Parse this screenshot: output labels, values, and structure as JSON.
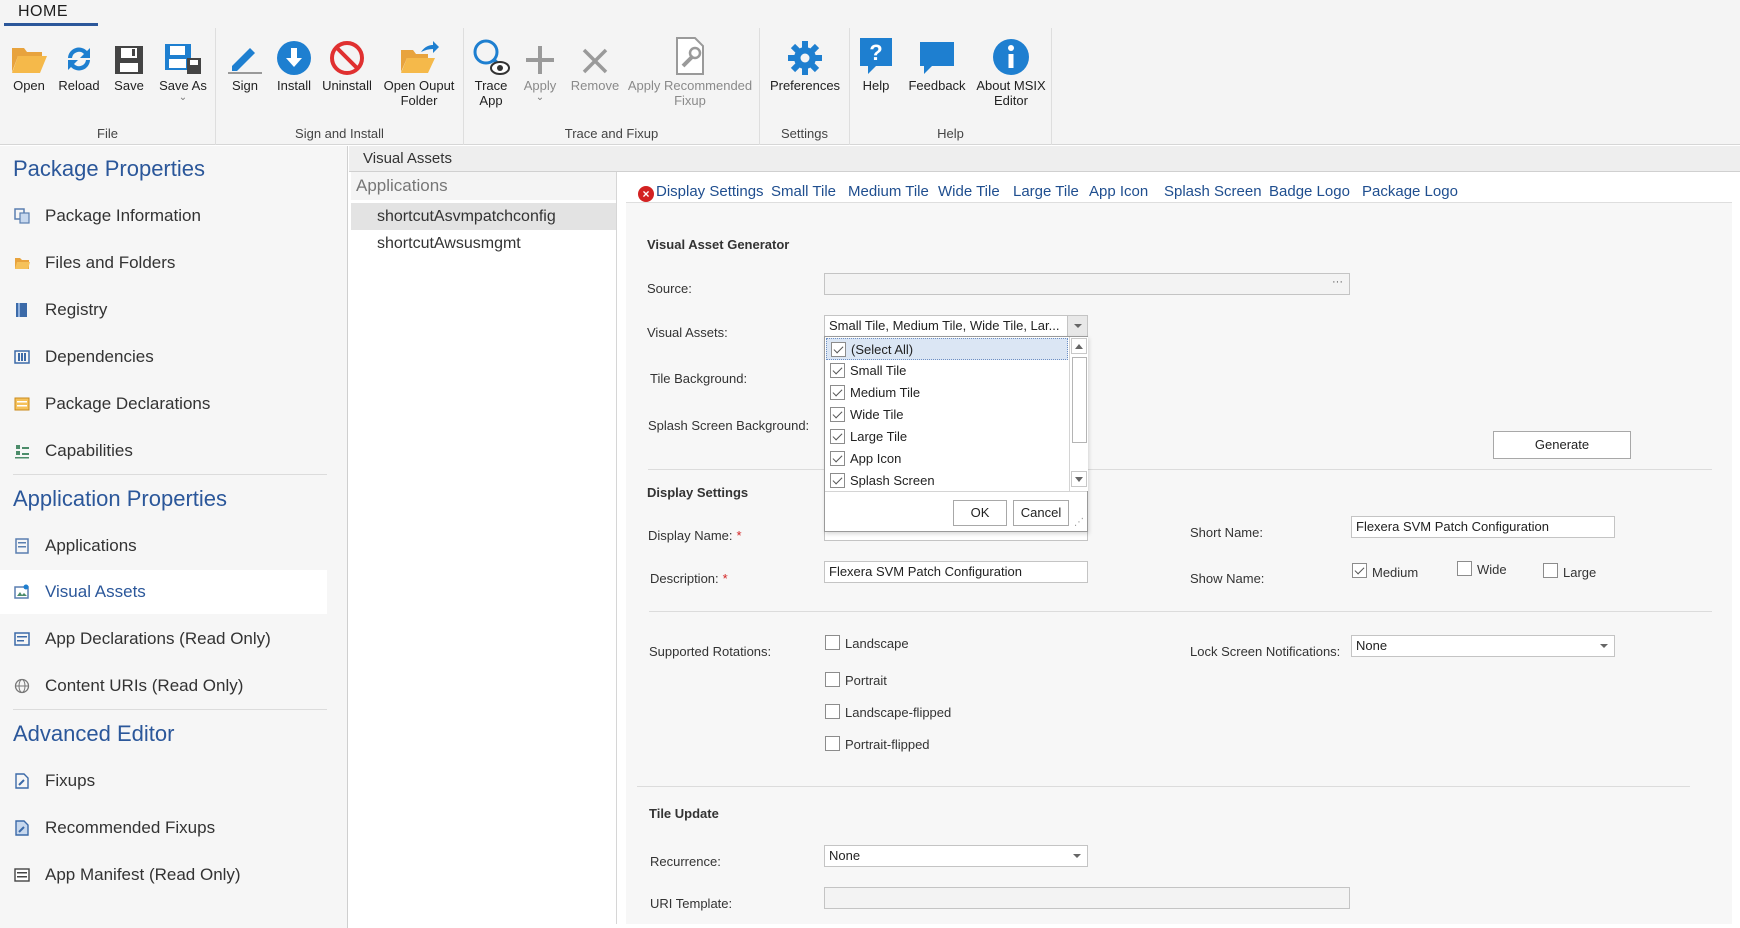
{
  "ribbon": {
    "tab": "HOME",
    "groups": [
      {
        "label": "File",
        "buttons": [
          {
            "label": "Open",
            "icon": "folder-open-icon"
          },
          {
            "label": "Reload",
            "icon": "reload-icon"
          },
          {
            "label": "Save",
            "icon": "save-icon"
          },
          {
            "label": "Save As",
            "icon": "save-as-icon"
          }
        ]
      },
      {
        "label": "Sign and Install",
        "buttons": [
          {
            "label": "Sign",
            "icon": "sign-pen-icon"
          },
          {
            "label": "Install",
            "icon": "install-icon"
          },
          {
            "label": "Uninstall",
            "icon": "uninstall-icon"
          },
          {
            "label": "Open Ouput",
            "label2": "Folder",
            "icon": "folder-export-icon"
          }
        ]
      },
      {
        "label": "Trace and Fixup",
        "buttons": [
          {
            "label": "Trace",
            "label2": "App",
            "icon": "trace-icon"
          },
          {
            "label": "Apply",
            "icon": "plus-icon"
          },
          {
            "label": "Remove",
            "icon": "remove-x-icon"
          },
          {
            "label": "Apply Recommended",
            "label2": "Fixup",
            "icon": "fixup-document-icon"
          }
        ]
      },
      {
        "label": "Settings",
        "buttons": [
          {
            "label": "Preferences",
            "icon": "gear-icon"
          }
        ]
      },
      {
        "label": "Help",
        "buttons": [
          {
            "label": "Help",
            "icon": "help-icon"
          },
          {
            "label": "Feedback",
            "icon": "feedback-icon"
          },
          {
            "label": "About MSIX",
            "label2": "Editor",
            "icon": "info-icon"
          }
        ]
      }
    ]
  },
  "nav": {
    "sections": [
      {
        "title": "Package Properties",
        "items": [
          "Package Information",
          "Files and Folders",
          "Registry",
          "Dependencies",
          "Package Declarations",
          "Capabilities"
        ]
      },
      {
        "title": "Application Properties",
        "items": [
          "Applications",
          "Visual Assets",
          "App Declarations (Read Only)",
          "Content URIs (Read Only)"
        ]
      },
      {
        "title": "Advanced Editor",
        "items": [
          "Fixups",
          "Recommended Fixups",
          "App Manifest (Read Only)"
        ]
      }
    ],
    "active": "Visual Assets"
  },
  "main": {
    "title": "Visual Assets",
    "applications_header": "Applications",
    "applications": [
      "shortcutAsvmpatchconfig",
      "shortcutAwsusmgmt"
    ]
  },
  "tabs": [
    "Display Settings",
    "Small Tile",
    "Medium Tile",
    "Wide Tile",
    "Large Tile",
    "App Icon",
    "Splash Screen",
    "Badge Logo",
    "Package Logo"
  ],
  "generator": {
    "heading": "Visual Asset Generator",
    "source_label": "Source:",
    "source_value": "",
    "source_browse": "···",
    "visual_assets_label": "Visual Assets:",
    "visual_assets_value": "Small Tile, Medium Tile, Wide Tile, Lar...",
    "tile_bg_label": "Tile Background:",
    "splash_bg_label": "Splash Screen Background:",
    "generate_button": "Generate"
  },
  "dropdown": {
    "options": [
      {
        "label": "(Select All)",
        "checked": true
      },
      {
        "label": "Small Tile",
        "checked": true
      },
      {
        "label": "Medium Tile",
        "checked": true
      },
      {
        "label": "Wide Tile",
        "checked": true
      },
      {
        "label": "Large Tile",
        "checked": true
      },
      {
        "label": "App Icon",
        "checked": true
      },
      {
        "label": "Splash Screen",
        "checked": true
      }
    ],
    "ok": "OK",
    "cancel": "Cancel"
  },
  "display": {
    "heading": "Display Settings",
    "display_name_label": "Display Name:",
    "description_label": "Description:",
    "description_value": "Flexera SVM Patch Configuration",
    "required_mark": "*",
    "short_name_label": "Short Name:",
    "short_name_value": "Flexera SVM Patch Configuration",
    "show_name_label": "Show Name:",
    "show_name_options": [
      {
        "label": "Medium",
        "checked": true
      },
      {
        "label": "Wide",
        "checked": false
      },
      {
        "label": "Large",
        "checked": false
      }
    ],
    "rotations_label": "Supported Rotations:",
    "rotations": [
      {
        "label": "Landscape",
        "checked": false
      },
      {
        "label": "Portrait",
        "checked": false
      },
      {
        "label": "Landscape-flipped",
        "checked": false
      },
      {
        "label": "Portrait-flipped",
        "checked": false
      }
    ],
    "lock_label": "Lock Screen Notifications:",
    "lock_value": "None"
  },
  "tile_update": {
    "heading": "Tile Update",
    "recurrence_label": "Recurrence:",
    "recurrence_value": "None",
    "uri_label": "URI Template:",
    "uri_value": ""
  },
  "colors": {
    "accent": "#2b579a",
    "icon_blue": "#1e7fd0",
    "error": "#d32222"
  }
}
